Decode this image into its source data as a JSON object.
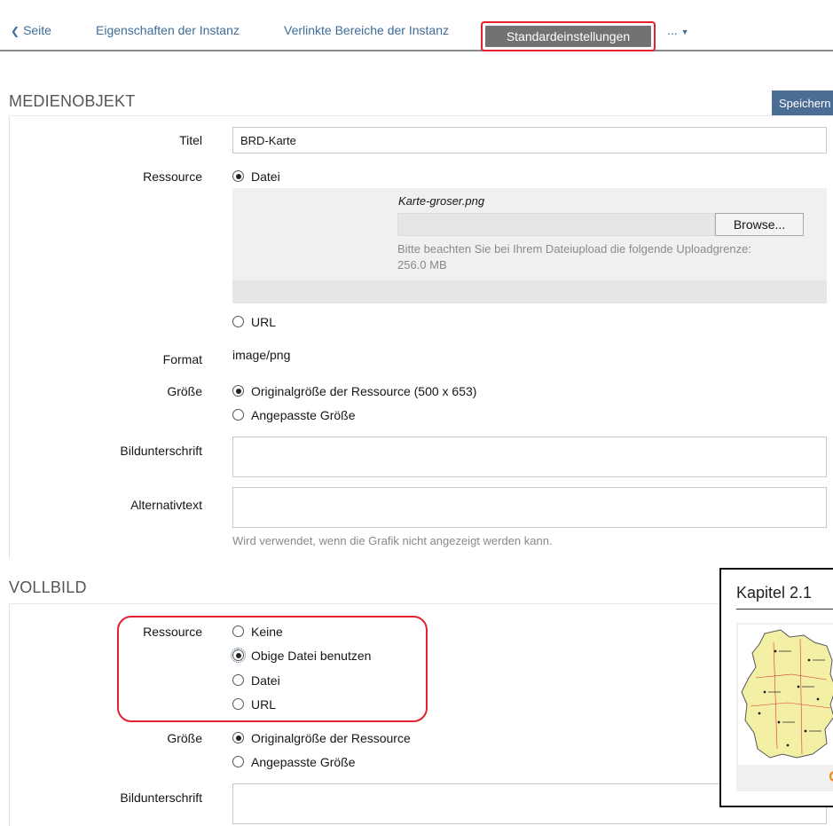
{
  "tabs": {
    "back": "Seite",
    "properties": "Eigenschaften der Instanz",
    "linked_areas": "Verlinkte Bereiche der Instanz",
    "defaults": "Standardeinstellungen",
    "more": "..."
  },
  "media_section": {
    "title": "MEDIENOBJEKT",
    "save_button": "Speichern",
    "title_label": "Titel",
    "title_value": "BRD-Karte",
    "resource_label": "Ressource",
    "resource_file": "Datei",
    "current_filename": "Karte-groser.png",
    "browse_button": "Browse...",
    "upload_hint": "Bitte beachten Sie bei Ihrem Dateiupload die folgende Uploadgrenze:",
    "upload_limit": "256.0 MB",
    "resource_url": "URL",
    "format_label": "Format",
    "format_value": "image/png",
    "size_label": "Größe",
    "size_original": "Originalgröße der Ressource (500 x 653)",
    "size_custom": "Angepasste Größe",
    "caption_label": "Bildunterschrift",
    "caption_value": "",
    "alt_label": "Alternativtext",
    "alt_value": "",
    "alt_hint": "Wird verwendet, wenn die Grafik nicht angezeigt werden kann."
  },
  "fullscreen_section": {
    "title": "VOLLBILD",
    "resource_label": "Ressource",
    "opt_none": "Keine",
    "opt_use_above": "Obige Datei benutzen",
    "opt_file": "Datei",
    "opt_url": "URL",
    "size_label": "Größe",
    "size_original": "Originalgröße der Ressource",
    "size_custom": "Angepasste Größe",
    "caption_label": "Bildunterschrift",
    "caption_value": ""
  },
  "preview": {
    "title": "Kapitel 2.1"
  },
  "colors": {
    "link": "#3f6c99",
    "active_tab": "#727272",
    "save_button": "#4c6d93",
    "highlight": "#e3202e",
    "map_fill": "#f3f0a6"
  }
}
